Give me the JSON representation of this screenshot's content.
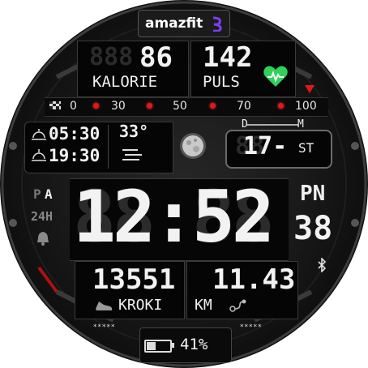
{
  "brand": {
    "name": "amazfit"
  },
  "top": {
    "calories_value": "86",
    "calories_ghost": "888",
    "calories_label": "KALORIE",
    "pulse_value": "142",
    "pulse_label": "PULS",
    "heart_color": "#2ed15a"
  },
  "pulse_scale": {
    "ticks": [
      "0",
      "30",
      "50",
      "70",
      "100"
    ],
    "marker_color": "#e01818"
  },
  "left_info": {
    "sunrise": "05:30",
    "sunset": "19:30",
    "temperature": "33°"
  },
  "date": {
    "day_marker_d": "D",
    "day_marker_m": "M",
    "day_value": "17-",
    "month_value": "ST"
  },
  "time": {
    "value": "12:52",
    "am_pm_p": "P",
    "am_pm_a": "A",
    "format": "24H",
    "weekday": "PN",
    "seconds": "38"
  },
  "bottom": {
    "steps_value": "13551",
    "steps_label": "KROKI",
    "distance_value": "11.43",
    "distance_label": "KM"
  },
  "footer": {
    "battery_percent": 41,
    "battery_text": "41%",
    "stars": "*****"
  },
  "colors": {
    "accent_red": "#e01818",
    "lcd_white": "#f2f2f2"
  }
}
